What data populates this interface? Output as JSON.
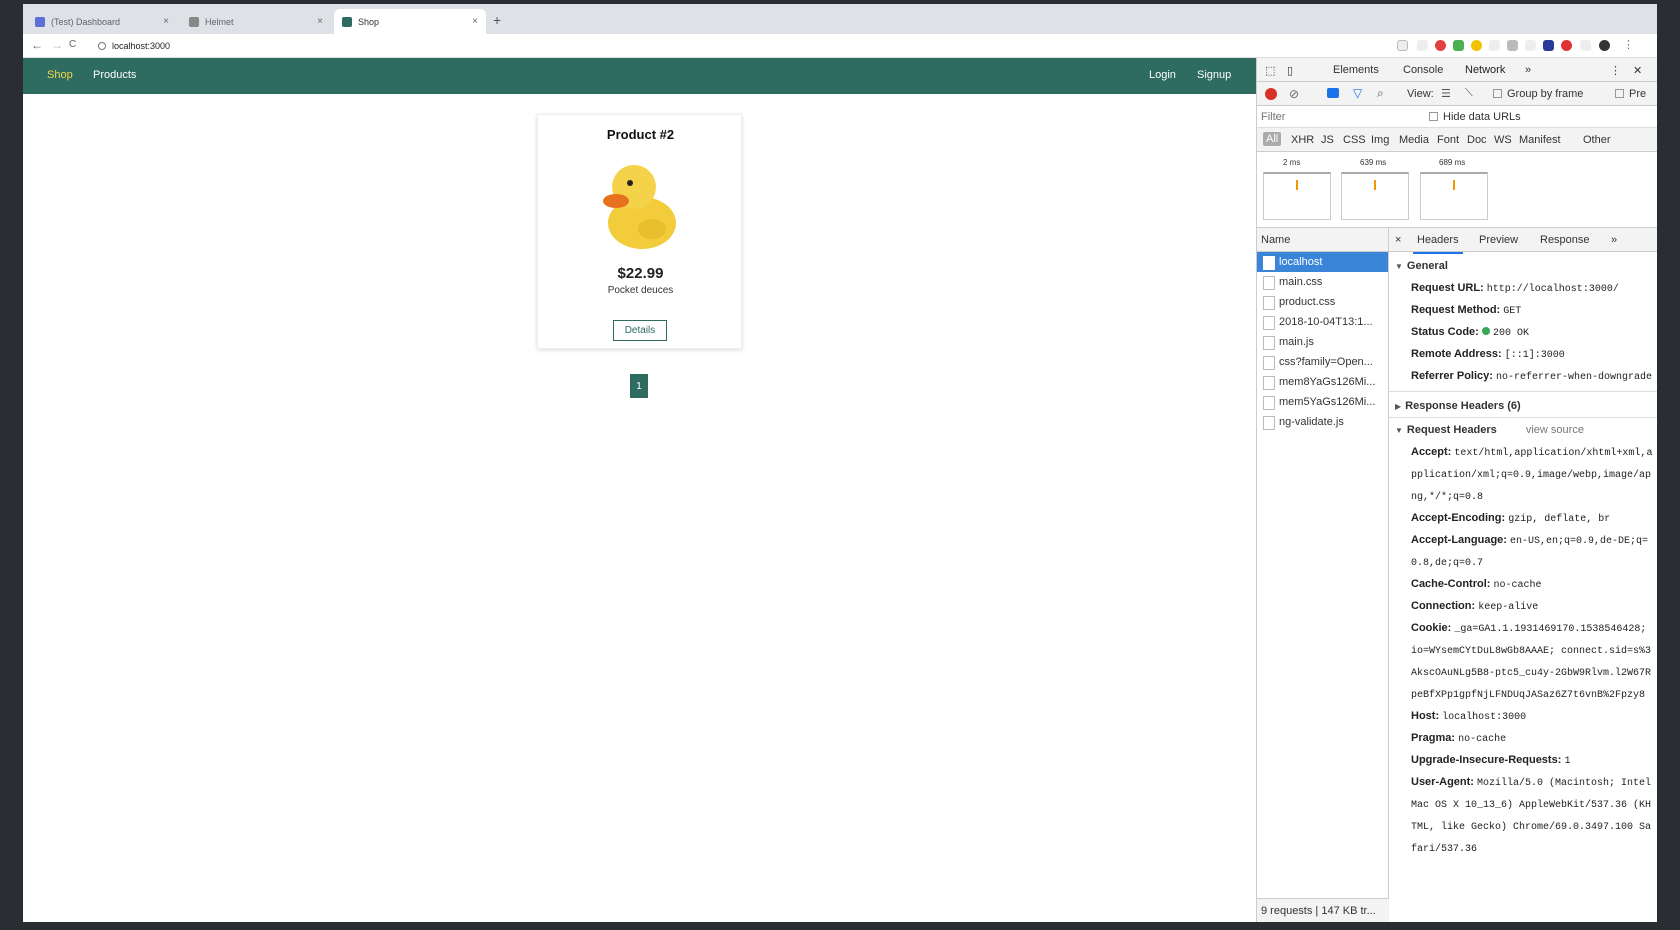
{
  "browser": {
    "tabs": [
      {
        "title": "(Test) Dashboard",
        "active": false
      },
      {
        "title": "Helmet",
        "active": false
      },
      {
        "title": "Shop",
        "active": true
      }
    ],
    "new_tab": "+",
    "url": "localhost:3000",
    "nav": {
      "back": "←",
      "forward": "→",
      "reload": "C"
    }
  },
  "site": {
    "nav": {
      "shop": "Shop",
      "products": "Products",
      "login": "Login",
      "signup": "Signup"
    },
    "product": {
      "title": "Product #2",
      "price": "$22.99",
      "description": "Pocket deuces",
      "details_label": "Details"
    },
    "pagination": {
      "current": "1"
    }
  },
  "devtools": {
    "tabs": {
      "elements": "Elements",
      "console": "Console",
      "network": "Network",
      "more": "»"
    },
    "toolbar": {
      "view": "View:",
      "group_by_frame": "Group by frame",
      "preserve": "Pre"
    },
    "filter_placeholder": "Filter",
    "hide_data_urls": "Hide data URLs",
    "type_filters": [
      "All",
      "XHR",
      "JS",
      "CSS",
      "Img",
      "Media",
      "Font",
      "Doc",
      "WS",
      "Manifest",
      "Other"
    ],
    "overview": [
      "2 ms",
      "639 ms",
      "689 ms"
    ],
    "name_header": "Name",
    "requests": [
      "localhost",
      "main.css",
      "product.css",
      "2018-10-04T13:1...",
      "main.js",
      "css?family=Open...",
      "mem8YaGs126Mi...",
      "mem5YaGs126Mi...",
      "ng-validate.js"
    ],
    "footer": "9 requests | 147 KB tr...",
    "detail_tabs": {
      "close": "×",
      "headers": "Headers",
      "preview": "Preview",
      "response": "Response",
      "more": "»"
    },
    "general": {
      "title": "General",
      "request_url_label": "Request URL:",
      "request_url": "http://localhost:3000/",
      "method_label": "Request Method:",
      "method": "GET",
      "status_label": "Status Code:",
      "status": "200 OK",
      "remote_label": "Remote Address:",
      "remote": "[::1]:3000",
      "referrer_label": "Referrer Policy:",
      "referrer": "no-referrer-when-downgrade"
    },
    "response_headers": "Response Headers (6)",
    "request_headers": {
      "title": "Request Headers",
      "view_source": "view source",
      "items": [
        {
          "k": "Accept:",
          "v": "text/html,application/xhtml+xml,application/xml;q=0.9,image/webp,image/apng,*/*;q=0.8"
        },
        {
          "k": "Accept-Encoding:",
          "v": "gzip, deflate, br"
        },
        {
          "k": "Accept-Language:",
          "v": "en-US,en;q=0.9,de-DE;q=0.8,de;q=0.7"
        },
        {
          "k": "Cache-Control:",
          "v": "no-cache"
        },
        {
          "k": "Connection:",
          "v": "keep-alive"
        },
        {
          "k": "Cookie:",
          "v": "_ga=GA1.1.1931469170.1538546428; io=WYsemCYtDuL8wGb8AAAE; connect.sid=s%3AkscOAuNLg5B8-ptc5_cu4y-2GbW9Rlvm.l2W67RpeBfXPp1gpfNjLFNDUqJASaz6Z7t6vnB%2Fpzy8"
        },
        {
          "k": "Host:",
          "v": "localhost:3000"
        },
        {
          "k": "Pragma:",
          "v": "no-cache"
        },
        {
          "k": "Upgrade-Insecure-Requests:",
          "v": "1"
        },
        {
          "k": "User-Agent:",
          "v": "Mozilla/5.0 (Macintosh; Intel Mac OS X 10_13_6) AppleWebKit/537.36 (KHTML, like Gecko) Chrome/69.0.3497.100 Safari/537.36"
        }
      ]
    }
  },
  "colors": {
    "nav_bg": "#2e6b60",
    "nav_active": "#f2d64b",
    "devtools_accent": "#1a73e8",
    "selected_row": "#3b85d9"
  }
}
